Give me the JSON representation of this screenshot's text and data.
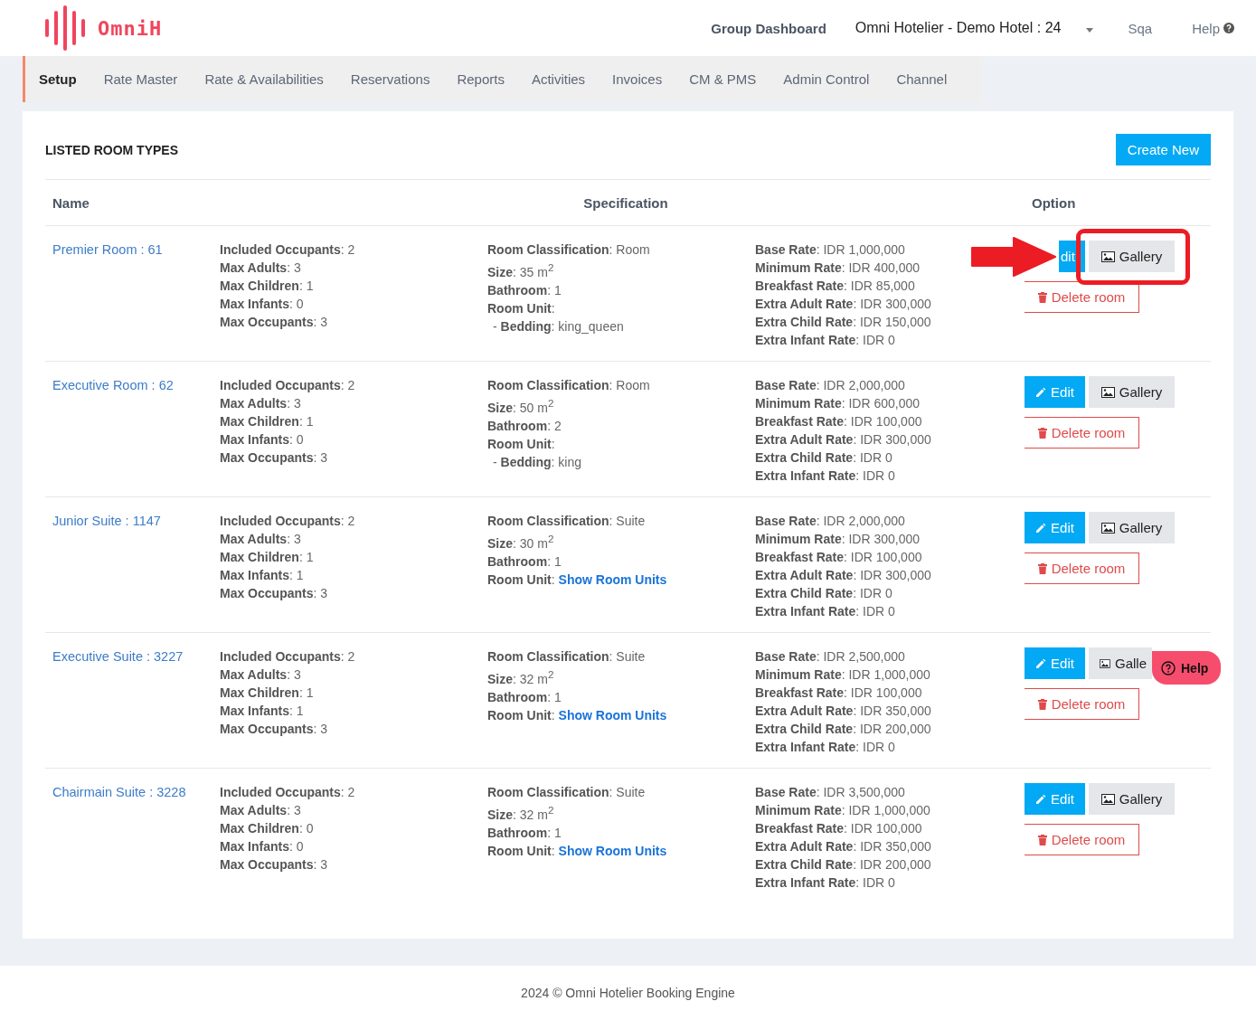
{
  "header": {
    "brand": "OmniH",
    "links": [
      {
        "label": "Group Dashboard",
        "kind": "bold"
      },
      {
        "label": "Omni Hotelier - Demo Hotel : 24",
        "kind": "hotel"
      },
      {
        "label": "Sqa",
        "kind": "plain"
      },
      {
        "label": "Help",
        "kind": "help"
      }
    ]
  },
  "nav": [
    {
      "label": "Setup",
      "selected": true
    },
    {
      "label": "Rate Master",
      "selected": false
    },
    {
      "label": "Rate & Availabilities",
      "selected": false
    },
    {
      "label": "Reservations",
      "selected": false
    },
    {
      "label": "Reports",
      "selected": false
    },
    {
      "label": "Activities",
      "selected": false
    },
    {
      "label": "Invoices",
      "selected": false
    },
    {
      "label": "CM & PMS",
      "selected": false
    },
    {
      "label": "Admin Control",
      "selected": false
    },
    {
      "label": "Channel",
      "selected": false
    }
  ],
  "panel": {
    "title": "LISTED ROOM TYPES",
    "create_button": "Create New",
    "columns": [
      "Name",
      "Specification",
      "Option"
    ]
  },
  "rooms": [
    {
      "name": "Premier Room : 61",
      "occupancy": [
        "**Included Occupants**: 2",
        "**Max Adults**: 3",
        "**Max Children**: 1",
        "**Max Infants**: 0",
        "**Max Occupants**: 3"
      ],
      "specs": [
        {
          "kind": "line",
          "text": "**Room Classification**: Room"
        },
        {
          "kind": "line",
          "text": "**Size**: 35 m$^{2}$"
        },
        {
          "kind": "line",
          "text": "**Bathroom**: 1"
        },
        {
          "kind": "line",
          "text": "**Room Unit**:"
        },
        {
          "kind": "sub",
          "text": "- **Bedding**: king_queen"
        }
      ],
      "rates": [
        "**Base Rate**: IDR 1,000,000",
        "**Minimum Rate**: IDR 400,000",
        "**Breakfast Rate**: IDR 85,000",
        "**Extra Adult Rate**: IDR 300,000",
        "**Extra Child Rate**: IDR 150,000",
        "**Extra Infant Rate**: IDR 0"
      ],
      "edit": "dit",
      "gallery": "Gallery",
      "delete": "Delete room",
      "annotated": true
    },
    {
      "name": "Executive Room : 62",
      "occupancy": [
        "**Included Occupants**: 2",
        "**Max Adults**: 3",
        "**Max Children**: 1",
        "**Max Infants**: 0",
        "**Max Occupants**: 3"
      ],
      "specs": [
        {
          "kind": "line",
          "text": "**Room Classification**: Room"
        },
        {
          "kind": "line",
          "text": "**Size**: 50 m$^{2}$"
        },
        {
          "kind": "line",
          "text": "**Bathroom**: 2"
        },
        {
          "kind": "line",
          "text": "**Room Unit**:"
        },
        {
          "kind": "sub",
          "text": "- **Bedding**: king"
        }
      ],
      "rates": [
        "**Base Rate**: IDR 2,000,000",
        "**Minimum Rate**: IDR 600,000",
        "**Breakfast Rate**: IDR 100,000",
        "**Extra Adult Rate**: IDR 300,000",
        "**Extra Child Rate**: IDR 0",
        "**Extra Infant Rate**: IDR 0"
      ],
      "edit": "Edit",
      "gallery": "Gallery",
      "delete": "Delete room"
    },
    {
      "name": "Junior Suite : 1147",
      "occupancy": [
        "**Included Occupants**: 2",
        "**Max Adults**: 3",
        "**Max Children**: 1",
        "**Max Infants**: 1",
        "**Max Occupants**: 3"
      ],
      "specs": [
        {
          "kind": "line",
          "text": "**Room Classification**: Suite"
        },
        {
          "kind": "line",
          "text": "**Size**: 30 m$^{2}$"
        },
        {
          "kind": "line",
          "text": "**Bathroom**: 1"
        },
        {
          "kind": "link",
          "text": "**Room Unit**: ",
          "link": "Show Room Units"
        }
      ],
      "rates": [
        "**Base Rate**: IDR 2,000,000",
        "**Minimum Rate**: IDR 300,000",
        "**Breakfast Rate**: IDR 100,000",
        "**Extra Adult Rate**: IDR 300,000",
        "**Extra Child Rate**: IDR 0",
        "**Extra Infant Rate**: IDR 0"
      ],
      "edit": "Edit",
      "gallery": "Gallery",
      "delete": "Delete room"
    },
    {
      "name": "Executive Suite : 3227",
      "occupancy": [
        "**Included Occupants**: 2",
        "**Max Adults**: 3",
        "**Max Children**: 1",
        "**Max Infants**: 1",
        "**Max Occupants**: 3"
      ],
      "specs": [
        {
          "kind": "line",
          "text": "**Room Classification**: Suite"
        },
        {
          "kind": "line",
          "text": "**Size**: 32 m$^{2}$"
        },
        {
          "kind": "line",
          "text": "**Bathroom**: 1"
        },
        {
          "kind": "link",
          "text": "**Room Unit**: ",
          "link": "Show Room Units"
        }
      ],
      "rates": [
        "**Base Rate**: IDR 2,500,000",
        "**Minimum Rate**: IDR 1,000,000",
        "**Breakfast Rate**: IDR 100,000",
        "**Extra Adult Rate**: IDR 350,000",
        "**Extra Child Rate**: IDR 200,000",
        "**Extra Infant Rate**: IDR 0"
      ],
      "edit": "Edit",
      "gallery": "Galle",
      "delete": "Delete room",
      "help_over": true
    },
    {
      "name": "Chairmain Suite : 3228",
      "occupancy": [
        "**Included Occupants**: 2",
        "**Max Adults**: 3",
        "**Max Children**: 0",
        "**Max Infants**: 0",
        "**Max Occupants**: 3"
      ],
      "specs": [
        {
          "kind": "line",
          "text": "**Room Classification**: Suite"
        },
        {
          "kind": "line",
          "text": "**Size**: 32 m$^{2}$"
        },
        {
          "kind": "line",
          "text": "**Bathroom**: 1"
        },
        {
          "kind": "link",
          "text": "**Room Unit**: ",
          "link": "Show Room Units"
        }
      ],
      "rates": [
        "**Base Rate**: IDR 3,500,000",
        "**Minimum Rate**: IDR 1,000,000",
        "**Breakfast Rate**: IDR 100,000",
        "**Extra Adult Rate**: IDR 350,000",
        "**Extra Child Rate**: IDR 200,000",
        "**Extra Infant Rate**: IDR 0"
      ],
      "edit": "Edit",
      "gallery": "Gallery",
      "delete": "Delete room"
    }
  ],
  "help_button": "Help",
  "footer": "2024 © Omni Hotelier Booking Engine"
}
